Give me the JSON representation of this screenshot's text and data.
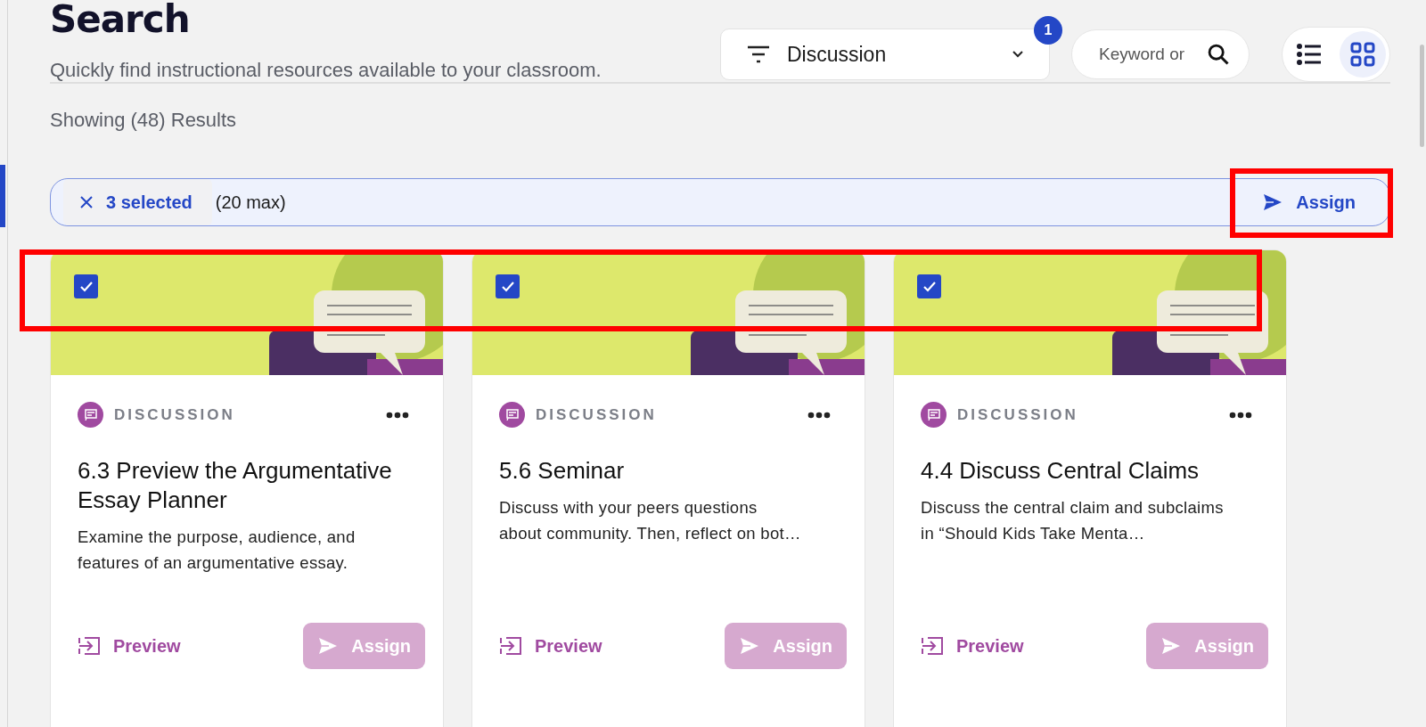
{
  "header": {
    "title": "Search",
    "subtitle": "Quickly find instructional resources available to your classroom."
  },
  "filter": {
    "value": "Discussion",
    "badge": "1"
  },
  "search": {
    "placeholder": "Keyword or"
  },
  "view_toggle": [
    {
      "kind": "list",
      "selected": false
    },
    {
      "kind": "grid",
      "selected": true
    }
  ],
  "results_count": "Showing (48) Results",
  "selection_bar": {
    "selected_label": "3 selected",
    "max_label": "(20 max)",
    "assign": "Assign"
  },
  "highlights": {
    "assign_button": true,
    "card_checkboxes": true
  },
  "cards": [
    {
      "checked": true,
      "type": "DISCUSSION",
      "title": "6.3 Preview the Argumentative Essay Planner",
      "description": "Examine the purpose, audience, and features of an argumentative essay.",
      "preview": "Preview",
      "assign": "Assign",
      "assign_disabled": true
    },
    {
      "checked": true,
      "type": "DISCUSSION",
      "title": "5.6 Seminar",
      "description": "Discuss with your peers questions about community. Then, reflect on bot…",
      "preview": "Preview",
      "assign": "Assign",
      "assign_disabled": true
    },
    {
      "checked": true,
      "type": "DISCUSSION",
      "title": "4.4 Discuss Central Claims",
      "description": "Discuss the central claim and subclaims in “Should Kids Take Menta…",
      "preview": "Preview",
      "assign": "Assign",
      "assign_disabled": true
    }
  ]
}
